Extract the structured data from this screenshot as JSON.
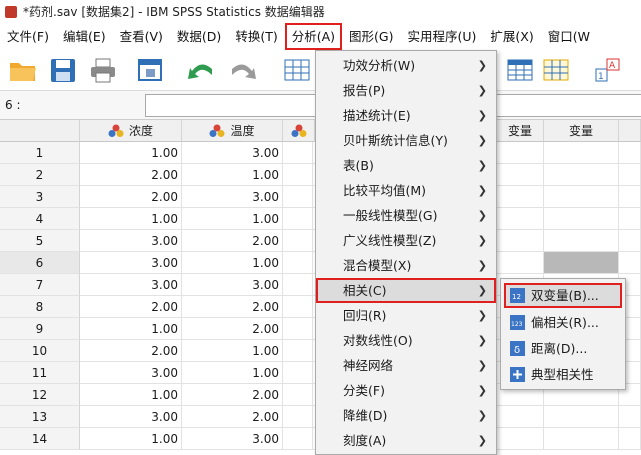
{
  "window": {
    "title": "*药剂.sav [数据集2] - IBM SPSS Statistics 数据编辑器"
  },
  "menubar": [
    {
      "label": "文件(F)"
    },
    {
      "label": "编辑(E)"
    },
    {
      "label": "查看(V)"
    },
    {
      "label": "数据(D)"
    },
    {
      "label": "转换(T)"
    },
    {
      "label": "分析(A)"
    },
    {
      "label": "图形(G)"
    },
    {
      "label": "实用程序(U)"
    },
    {
      "label": "扩展(X)"
    },
    {
      "label": "窗口(W"
    }
  ],
  "cellref": {
    "label": "6 :",
    "value": ""
  },
  "columns": [
    "浓度",
    "温度",
    "变量"
  ],
  "rows": [
    {
      "n": "1",
      "c1": "1.00",
      "c2": "3.00"
    },
    {
      "n": "2",
      "c1": "2.00",
      "c2": "1.00"
    },
    {
      "n": "3",
      "c1": "2.00",
      "c2": "3.00"
    },
    {
      "n": "4",
      "c1": "1.00",
      "c2": "1.00"
    },
    {
      "n": "5",
      "c1": "3.00",
      "c2": "2.00"
    },
    {
      "n": "6",
      "c1": "3.00",
      "c2": "1.00"
    },
    {
      "n": "7",
      "c1": "3.00",
      "c2": "3.00"
    },
    {
      "n": "8",
      "c1": "2.00",
      "c2": "2.00"
    },
    {
      "n": "9",
      "c1": "1.00",
      "c2": "2.00"
    },
    {
      "n": "10",
      "c1": "2.00",
      "c2": "1.00"
    },
    {
      "n": "11",
      "c1": "3.00",
      "c2": "1.00"
    },
    {
      "n": "12",
      "c1": "1.00",
      "c2": "2.00"
    },
    {
      "n": "13",
      "c1": "3.00",
      "c2": "2.00"
    },
    {
      "n": "14",
      "c1": "1.00",
      "c2": "3.00"
    }
  ],
  "analyze_menu": [
    {
      "label": "功效分析(W)"
    },
    {
      "label": "报告(P)"
    },
    {
      "label": "描述统计(E)"
    },
    {
      "label": "贝叶斯统计信息(Y)"
    },
    {
      "label": "表(B)"
    },
    {
      "label": "比较平均值(M)"
    },
    {
      "label": "一般线性模型(G)"
    },
    {
      "label": "广义线性模型(Z)"
    },
    {
      "label": "混合模型(X)"
    },
    {
      "label": "相关(C)"
    },
    {
      "label": "回归(R)"
    },
    {
      "label": "对数线性(O)"
    },
    {
      "label": "神经网络"
    },
    {
      "label": "分类(F)"
    },
    {
      "label": "降维(D)"
    },
    {
      "label": "刻度(A)"
    }
  ],
  "correlate_submenu": [
    {
      "label": "双变量(B)...",
      "icon": "bivariate-icon"
    },
    {
      "label": "偏相关(R)...",
      "icon": "partial-icon"
    },
    {
      "label": "距离(D)...",
      "icon": "distance-icon"
    },
    {
      "label": "典型相关性",
      "icon": "canonical-icon"
    }
  ],
  "colors": {
    "highlight_border": "#e0201f",
    "accent": "#2b6cb0"
  }
}
